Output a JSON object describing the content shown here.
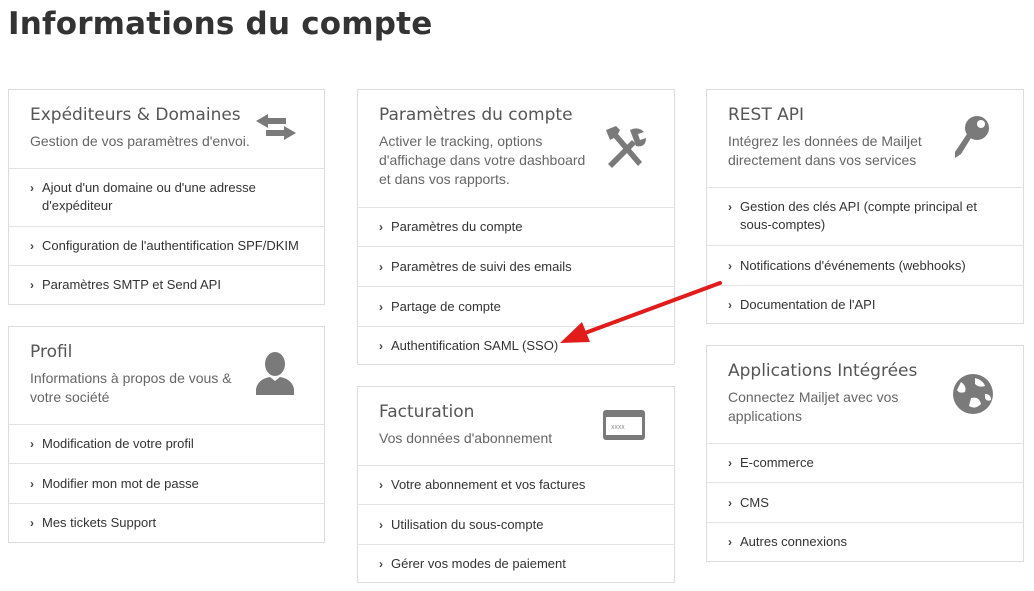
{
  "page": {
    "title": "Informations du compte"
  },
  "cards": {
    "senders": {
      "title": "Expéditeurs & Domaines",
      "desc": "Gestion de vos paramètres d'envoi.",
      "icon": "swap-arrows-icon",
      "items": [
        "Ajout d'un domaine ou d'une adresse d'expéditeur",
        "Configuration de l'authentification SPF/DKIM",
        "Paramètres SMTP et Send API"
      ]
    },
    "profile": {
      "title": "Profil",
      "desc": "Informations à propos de vous & votre société",
      "icon": "user-icon",
      "items": [
        "Modification de votre profil",
        "Modifier mon mot de passe",
        "Mes tickets Support"
      ]
    },
    "account": {
      "title": "Paramètres du compte",
      "desc": "Activer le tracking, options d'affichage dans votre dashboard et dans vos rapports.",
      "icon": "tools-icon",
      "items": [
        "Paramètres du compte",
        "Paramètres de suivi des emails",
        "Partage de compte",
        "Authentification SAML (SSO)"
      ]
    },
    "billing": {
      "title": "Facturation",
      "desc": "Vos données d'abonnement",
      "icon": "credit-card-icon",
      "card_text": "XXXX",
      "items": [
        "Votre abonnement et vos factures",
        "Utilisation du sous-compte",
        "Gérer vos modes de paiement"
      ]
    },
    "api": {
      "title": "REST API",
      "desc": "Intégrez les données de Mailjet directement dans vos services",
      "icon": "key-icon",
      "items": [
        "Gestion des clés API (compte principal et sous-comptes)",
        "Notifications d'événements (webhooks)",
        "Documentation de l'API"
      ]
    },
    "apps": {
      "title": "Applications Intégrées",
      "desc": "Connectez Mailjet avec vos applications",
      "icon": "globe-icon",
      "items": [
        "E-commerce",
        "CMS",
        "Autres connexions"
      ]
    }
  },
  "colors": {
    "annotation_arrow": "#e21b1b",
    "icon": "#7a7a7a"
  }
}
